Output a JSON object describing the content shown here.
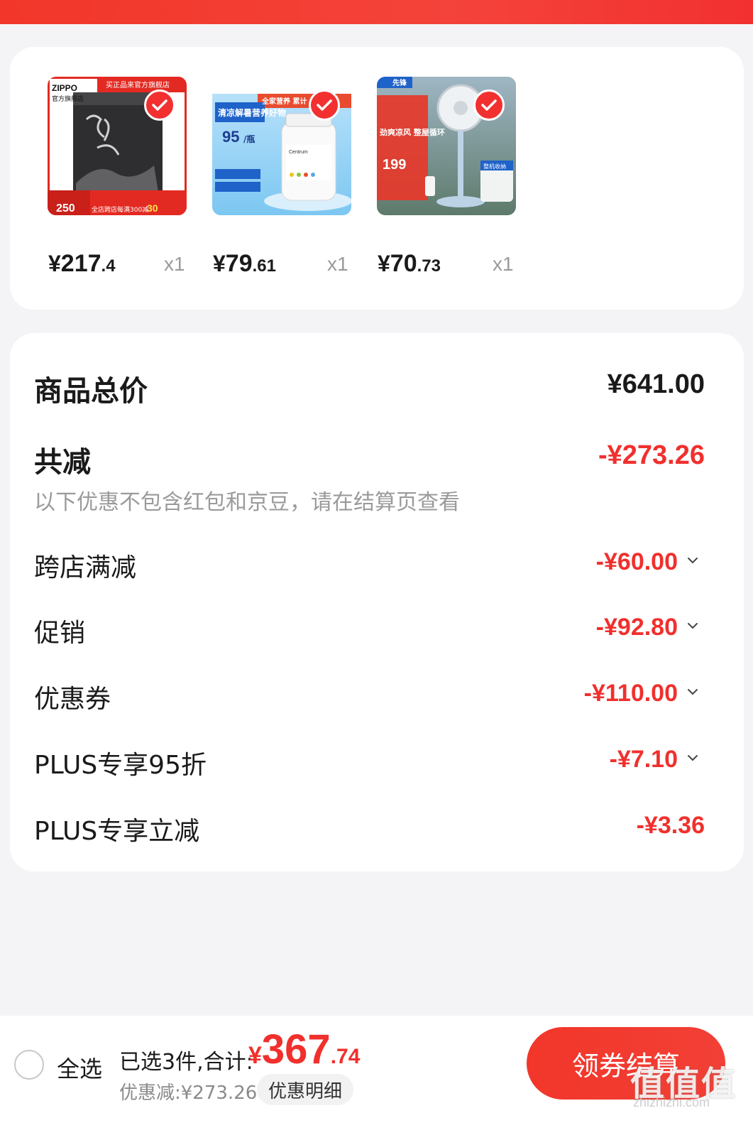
{
  "products": [
    {
      "price_yen": "¥",
      "price_int": "217",
      "price_dec": ".4",
      "qty": "x1",
      "badge_text": "ZIPPO",
      "badge_sub": "官方旗舰店",
      "banner": "买正品来官方旗舰店",
      "promo": "250",
      "promo2": "30",
      "promo3": "全店跨店每满300减"
    },
    {
      "price_yen": "¥",
      "price_int": "79",
      "price_dec": ".61",
      "qty": "x1",
      "headline": "清凉解暑营养好物",
      "price_tag": "95",
      "price_unit": "/瓶",
      "banner": "全家营养 累计",
      "bottle": "Centrum"
    },
    {
      "price_yen": "¥",
      "price_int": "70",
      "price_dec": ".73",
      "qty": "x1",
      "brand": "先锋",
      "headline": "劲爽凉风 整屋循环",
      "price_tag": "199",
      "tag2": "整机收纳"
    }
  ],
  "summary": {
    "total_label": "商品总价",
    "total_value": "¥641.00",
    "reduce_label": "共减",
    "reduce_value": "-¥273.26",
    "note": "以下优惠不包含红包和京豆，请在结算页查看",
    "items": [
      {
        "label": "跨店满减",
        "value": "-¥60.00"
      },
      {
        "label": "促销",
        "value": "-¥92.80"
      },
      {
        "label": "优惠券",
        "value": "-¥110.00"
      },
      {
        "label": "PLUS专享95折",
        "value": "-¥7.10"
      },
      {
        "label": "PLUS专享立减",
        "value": "-¥3.36"
      }
    ]
  },
  "footer": {
    "select_all": "全选",
    "selected": "已选3件,合计:",
    "sum_yen": "¥",
    "sum_int": "367",
    "sum_dec": ".74",
    "discount": "优惠减:¥273.26",
    "detail_button": "优惠明细",
    "checkout_button": "领券结算",
    "watermark": "值值值",
    "watermark_sub": "zhizhizhi.com"
  },
  "colors": {
    "accent": "#f0302d",
    "background": "#f4f4f6"
  }
}
